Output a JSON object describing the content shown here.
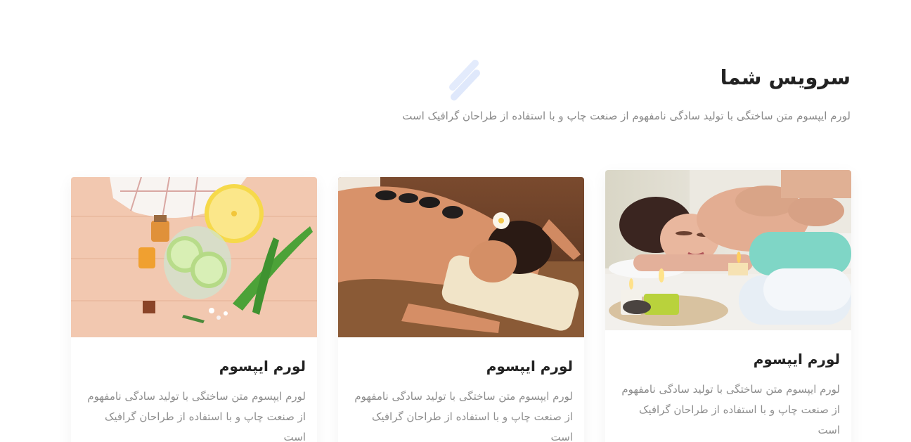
{
  "section": {
    "title": "سرویس شما",
    "subtitle": "لورم ایپسوم متن ساختگی با تولید سادگی نامفهوم از صنعت چاپ و با استفاده از طراحان گرافیک است",
    "accent_color": "#dfe8fb"
  },
  "cards": [
    {
      "image": "spa-massage-shoulder-image",
      "title": "لورم ایپسوم",
      "text": "لورم ایپسوم متن ساختگی با تولید سادگی نامفهوم از صنعت چاپ و با استفاده از طراحان گرافیک است"
    },
    {
      "image": "hot-stone-massage-image",
      "title": "لورم ایپسوم",
      "text": "لورم ایپسوم متن ساختگی با تولید سادگی نامفهوم از صنعت چاپ و با استفاده از طراحان گرافیک است"
    },
    {
      "image": "cucumber-aloe-ingredients-image",
      "title": "لورم ایپسوم",
      "text": "لورم ایپسوم متن ساختگی با تولید سادگی نامفهوم از صنعت چاپ و با استفاده از طراحان گرافیک است"
    }
  ]
}
